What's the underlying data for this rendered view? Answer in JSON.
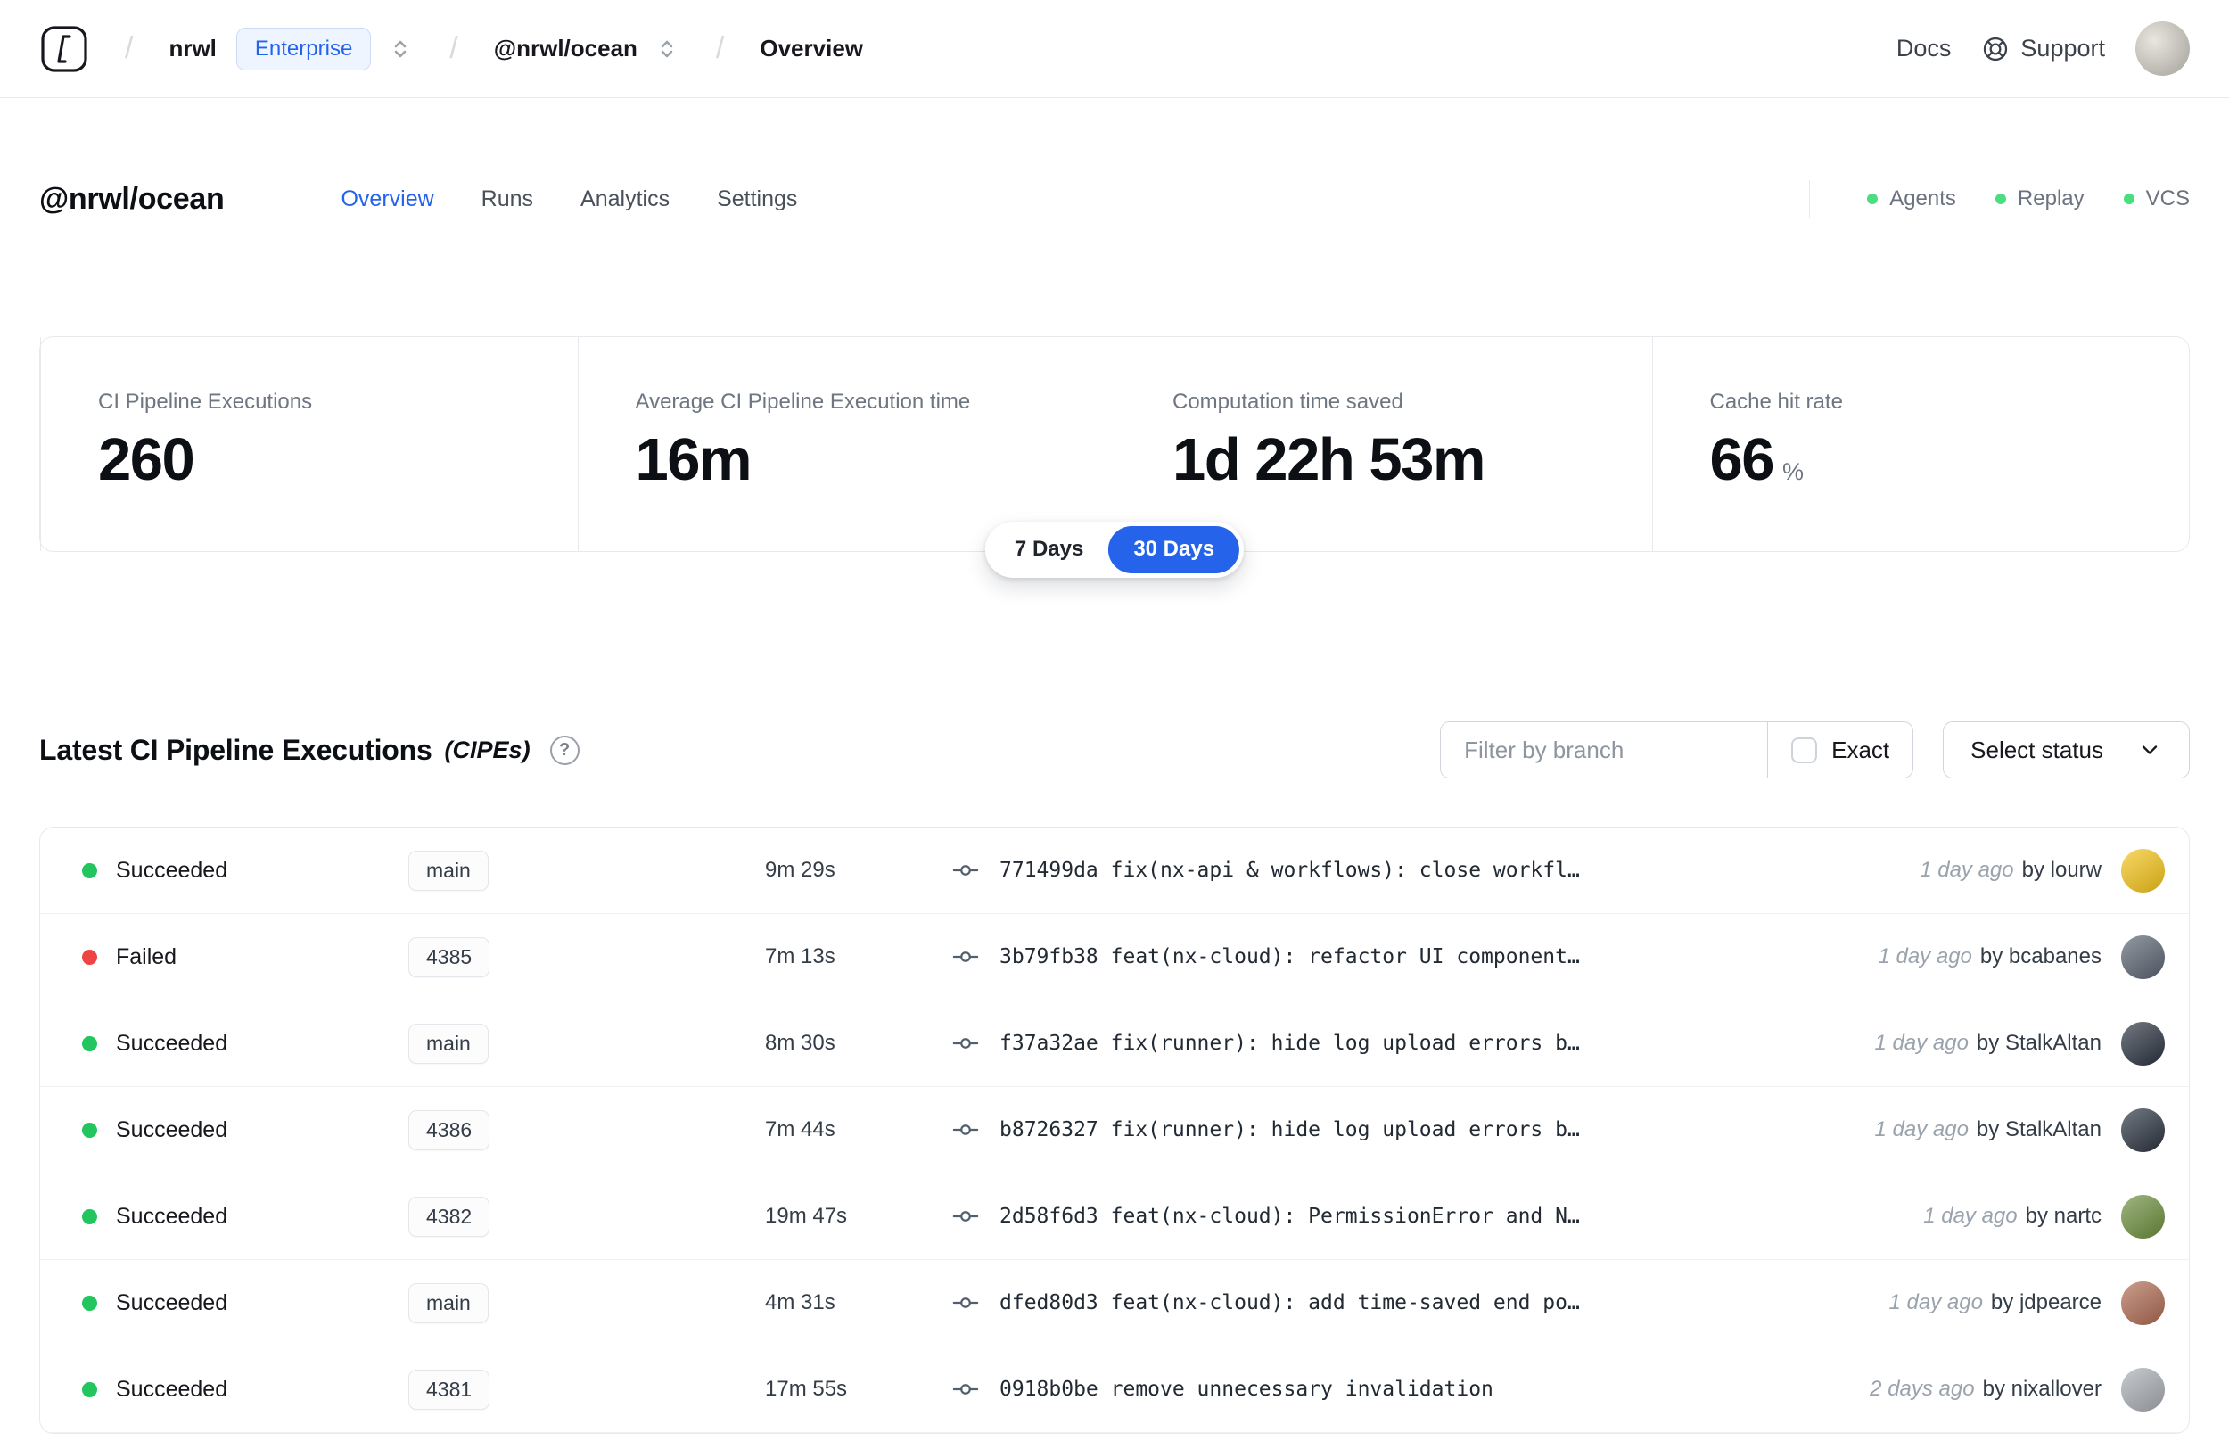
{
  "topnav": {
    "org": "nrwl",
    "org_badge": "Enterprise",
    "workspace": "@nrwl/ocean",
    "page": "Overview",
    "docs": "Docs",
    "support": "Support"
  },
  "header": {
    "title": "@nrwl/ocean",
    "tabs": [
      {
        "label": "Overview",
        "active": true
      },
      {
        "label": "Runs",
        "active": false
      },
      {
        "label": "Analytics",
        "active": false
      },
      {
        "label": "Settings",
        "active": false
      }
    ],
    "statuses": [
      {
        "label": "Agents"
      },
      {
        "label": "Replay"
      },
      {
        "label": "VCS"
      }
    ],
    "status_dot_color": "#4ade80"
  },
  "stats": {
    "cards": [
      {
        "label": "CI Pipeline Executions",
        "value": "260",
        "suffix": ""
      },
      {
        "label": "Average CI Pipeline Execution time",
        "value": "16m",
        "suffix": ""
      },
      {
        "label": "Computation time saved",
        "value": "1d 22h 53m",
        "suffix": ""
      },
      {
        "label": "Cache hit rate",
        "value": "66",
        "suffix": "%"
      }
    ],
    "range": [
      {
        "label": "7 Days",
        "active": false
      },
      {
        "label": "30 Days",
        "active": true
      }
    ]
  },
  "cipe": {
    "title": "Latest CI Pipeline Executions",
    "suffix": "(CIPEs)",
    "filter_placeholder": "Filter by branch",
    "exact": "Exact",
    "select_status": "Select status",
    "rows": [
      {
        "status": "Succeeded",
        "dot_color": "#22c55e",
        "branch": "main",
        "duration": "9m 29s",
        "commit": "771499da fix(nx-api & workflows): close workfl…",
        "time": "1 day ago",
        "author": "by lourw",
        "avatar_color": "#f5c518"
      },
      {
        "status": "Failed",
        "dot_color": "#ef4444",
        "branch": "4385",
        "duration": "7m 13s",
        "commit": "3b79fb38 feat(nx-cloud): refactor UI component…",
        "time": "1 day ago",
        "author": "by bcabanes",
        "avatar_color": "#5b6472"
      },
      {
        "status": "Succeeded",
        "dot_color": "#22c55e",
        "branch": "main",
        "duration": "8m 30s",
        "commit": "f37a32ae fix(runner): hide log upload errors b…",
        "time": "1 day ago",
        "author": "by StalkAltan",
        "avatar_color": "#2a3340"
      },
      {
        "status": "Succeeded",
        "dot_color": "#22c55e",
        "branch": "4386",
        "duration": "7m 44s",
        "commit": "b8726327 fix(runner): hide log upload errors b…",
        "time": "1 day ago",
        "author": "by StalkAltan",
        "avatar_color": "#2a3340"
      },
      {
        "status": "Succeeded",
        "dot_color": "#22c55e",
        "branch": "4382",
        "duration": "19m 47s",
        "commit": "2d58f6d3 feat(nx-cloud): PermissionError and N…",
        "time": "1 day ago",
        "author": "by nartc",
        "avatar_color": "#6d8f3d"
      },
      {
        "status": "Succeeded",
        "dot_color": "#22c55e",
        "branch": "main",
        "duration": "4m 31s",
        "commit": "dfed80d3 feat(nx-cloud): add time-saved end po…",
        "time": "1 day ago",
        "author": "by jdpearce",
        "avatar_color": "#b06a52"
      },
      {
        "status": "Succeeded",
        "dot_color": "#22c55e",
        "branch": "4381",
        "duration": "17m 55s",
        "commit": "0918b0be remove unnecessary invalidation",
        "time": "2 days ago",
        "author": "by nixallover",
        "avatar_color": "#a9aeb4"
      }
    ]
  },
  "colors": {
    "accent": "#2563eb",
    "success": "#22c55e",
    "failed": "#ef4444"
  }
}
